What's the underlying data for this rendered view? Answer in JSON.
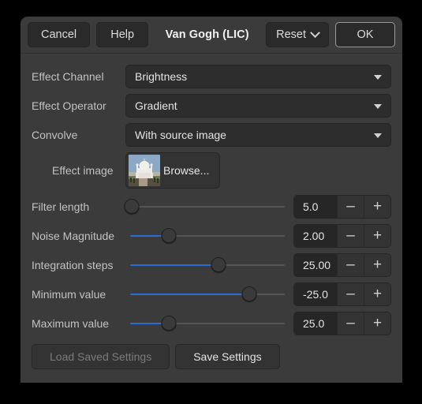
{
  "header": {
    "cancel_label": "Cancel",
    "help_label": "Help",
    "title": "Van Gogh (LIC)",
    "reset_label": "Reset",
    "ok_label": "OK"
  },
  "combos": [
    {
      "label": "Effect Channel",
      "value": "Brightness"
    },
    {
      "label": "Effect Operator",
      "value": "Gradient"
    },
    {
      "label": "Convolve",
      "value": "With source image"
    }
  ],
  "effect_image": {
    "label": "Effect image",
    "browse_label": "Browse..."
  },
  "sliders": [
    {
      "label": "Filter length",
      "value": "5.0",
      "fill_pct": 1,
      "knob_pct": 1
    },
    {
      "label": "Noise Magnitude",
      "value": "2.00",
      "fill_pct": 25,
      "knob_pct": 25
    },
    {
      "label": "Integration steps",
      "value": "25.00",
      "fill_pct": 57,
      "knob_pct": 57
    },
    {
      "label": "Minimum value",
      "value": "-25.0",
      "fill_pct": 77,
      "knob_pct": 77
    },
    {
      "label": "Maximum value",
      "value": "25.0",
      "fill_pct": 25,
      "knob_pct": 25
    }
  ],
  "spin": {
    "minus": "–",
    "plus": "+"
  },
  "bottom": {
    "load_label": "Load Saved Settings",
    "save_label": "Save Settings"
  },
  "colors": {
    "dialog_bg": "#3b3b3b",
    "accent": "#2a6cd4",
    "text": "#e4e4e4",
    "muted_text": "#7b7b7b"
  }
}
